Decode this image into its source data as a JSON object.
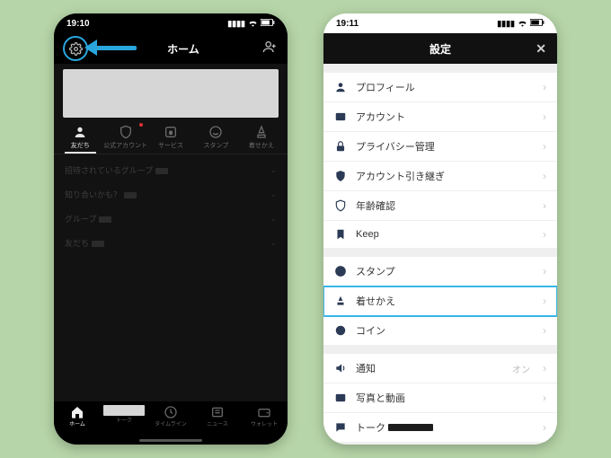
{
  "left": {
    "time": "19:10",
    "title": "ホーム",
    "tabs": [
      {
        "label": "友だち"
      },
      {
        "label": "公式アカウント"
      },
      {
        "label": "サービス"
      },
      {
        "label": "スタンプ"
      },
      {
        "label": "着せかえ"
      }
    ],
    "groups": [
      {
        "label": "招待されているグループ"
      },
      {
        "label": "知り合いかも？"
      },
      {
        "label": "グループ"
      },
      {
        "label": "友だち"
      }
    ],
    "bottom": [
      {
        "label": "ホーム"
      },
      {
        "label": "トーク"
      },
      {
        "label": "タイムライン"
      },
      {
        "label": "ニュース"
      },
      {
        "label": "ウォレット"
      }
    ]
  },
  "right": {
    "time": "19:11",
    "title": "設定",
    "section1": [
      {
        "icon": "person",
        "label": "プロフィール"
      },
      {
        "icon": "id",
        "label": "アカウント"
      },
      {
        "icon": "lock",
        "label": "プライバシー管理"
      },
      {
        "icon": "shield",
        "label": "アカウント引き継ぎ"
      },
      {
        "icon": "shield2",
        "label": "年齢確認"
      },
      {
        "icon": "bookmark",
        "label": "Keep"
      }
    ],
    "section2": [
      {
        "icon": "smile",
        "label": "スタンプ"
      },
      {
        "icon": "brush",
        "label": "着せかえ",
        "hl": true
      },
      {
        "icon": "coin",
        "label": "コイン"
      }
    ],
    "section3": [
      {
        "icon": "speaker",
        "label": "通知",
        "tail": "オン"
      },
      {
        "icon": "photo",
        "label": "写真と動画"
      },
      {
        "icon": "chat",
        "label": "トーク"
      }
    ]
  }
}
